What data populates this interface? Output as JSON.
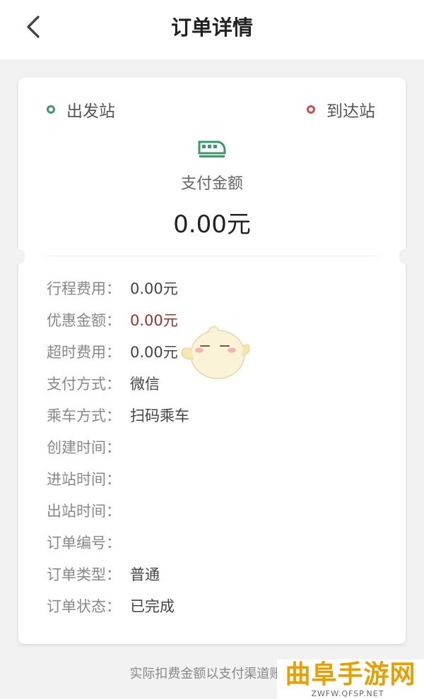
{
  "header": {
    "title": "订单详情",
    "back_icon": "chevron-left-icon"
  },
  "route": {
    "departure": "出发站",
    "arrival": "到达站",
    "icon": "train-icon"
  },
  "payment": {
    "label": "支付金额",
    "amount": "0.00元"
  },
  "details": [
    {
      "key": "行程费用：",
      "value": "0.00元"
    },
    {
      "key": "优惠金额：",
      "value": "0.00元"
    },
    {
      "key": "超时费用：",
      "value": "0.00元"
    },
    {
      "key": "支付方式：",
      "value": "微信"
    },
    {
      "key": "乘车方式：",
      "value": "扫码乘车"
    },
    {
      "key": "创建时间：",
      "value": ""
    },
    {
      "key": "进站时间：",
      "value": ""
    },
    {
      "key": "出站时间：",
      "value": ""
    },
    {
      "key": "订单编号：",
      "value": ""
    },
    {
      "key": "订单类型：",
      "value": "普通"
    },
    {
      "key": "订单状态：",
      "value": "已完成"
    }
  ],
  "footer": {
    "note": "实际扣费金额以支付渠道账..."
  },
  "watermark": {
    "main": "曲阜手游网",
    "sub": "ZWFW.QFSP.NET"
  },
  "colors": {
    "departure_dot": "#3a9a6a",
    "arrival_dot": "#c85050",
    "discount_value": "#a0302a",
    "watermark": "#e8a000",
    "train_icon": "#3a9a6a"
  }
}
